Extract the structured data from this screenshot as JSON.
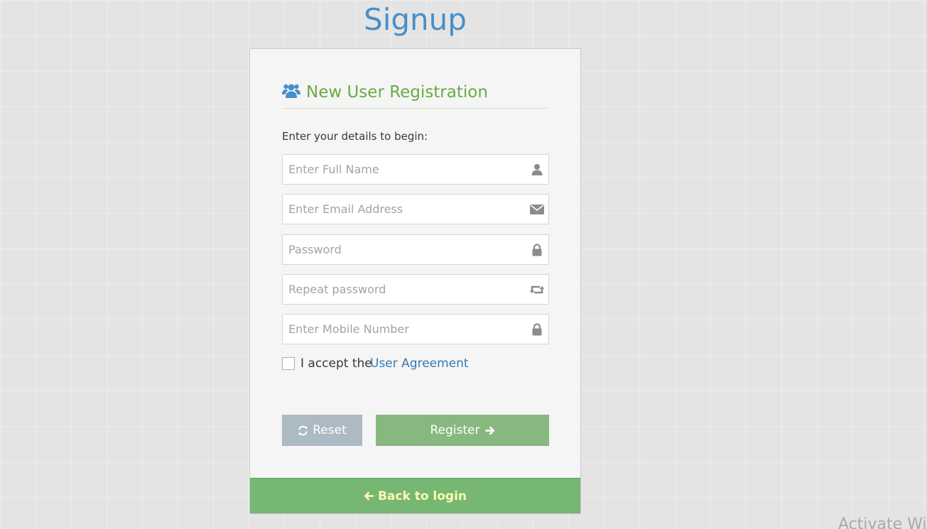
{
  "page": {
    "title": "Signup",
    "watermark": "Activate Wi"
  },
  "form": {
    "header": "New User Registration",
    "header_icon": "users-icon",
    "intro": "Enter your details to begin:",
    "fields": [
      {
        "placeholder": "Enter Full Name",
        "value": "",
        "icon": "user-icon"
      },
      {
        "placeholder": "Enter Email Address",
        "value": "",
        "icon": "envelope-icon"
      },
      {
        "placeholder": "Password",
        "value": "",
        "icon": "lock-icon"
      },
      {
        "placeholder": "Repeat password",
        "value": "",
        "icon": "retweet-icon"
      },
      {
        "placeholder": "Enter Mobile Number",
        "value": "",
        "icon": "lock-icon"
      }
    ],
    "agreement": {
      "checked": false,
      "text": "I accept the",
      "link": "User Agreement"
    },
    "buttons": {
      "reset": "Reset",
      "register": "Register"
    },
    "back_link": "Back to login"
  },
  "colors": {
    "title": "#478fca",
    "header": "#69aa46",
    "link": "#337ab7",
    "reset_button": "#abbac3",
    "register_button": "#87b87f",
    "toolbar": "#76b774",
    "back_link": "#fef9b0"
  }
}
